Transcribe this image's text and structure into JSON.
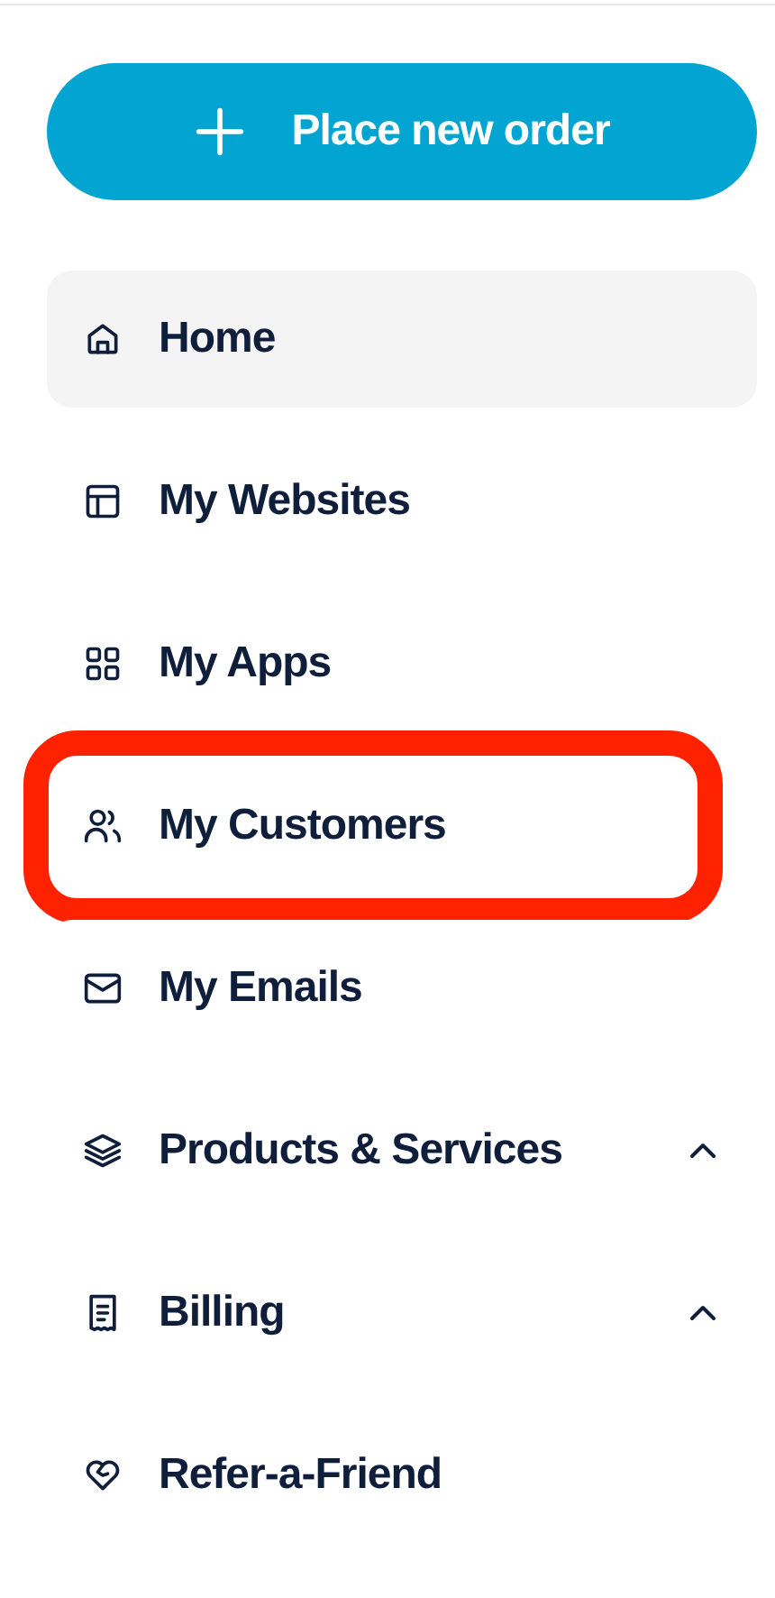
{
  "order_button": {
    "label": "Place new order"
  },
  "nav": [
    {
      "label": "Home",
      "kind": "link",
      "selected": true,
      "highlighted": false
    },
    {
      "label": "My Websites",
      "kind": "link",
      "selected": false,
      "highlighted": false
    },
    {
      "label": "My Apps",
      "kind": "link",
      "selected": false,
      "highlighted": false
    },
    {
      "label": "My Customers",
      "kind": "link",
      "selected": false,
      "highlighted": true
    },
    {
      "label": "My Emails",
      "kind": "link",
      "selected": false,
      "highlighted": false
    },
    {
      "label": "Products & Services",
      "kind": "group",
      "selected": false,
      "highlighted": false
    },
    {
      "label": "Billing",
      "kind": "group",
      "selected": false,
      "highlighted": false
    },
    {
      "label": "Refer-a-Friend",
      "kind": "link",
      "selected": false,
      "highlighted": false
    }
  ]
}
